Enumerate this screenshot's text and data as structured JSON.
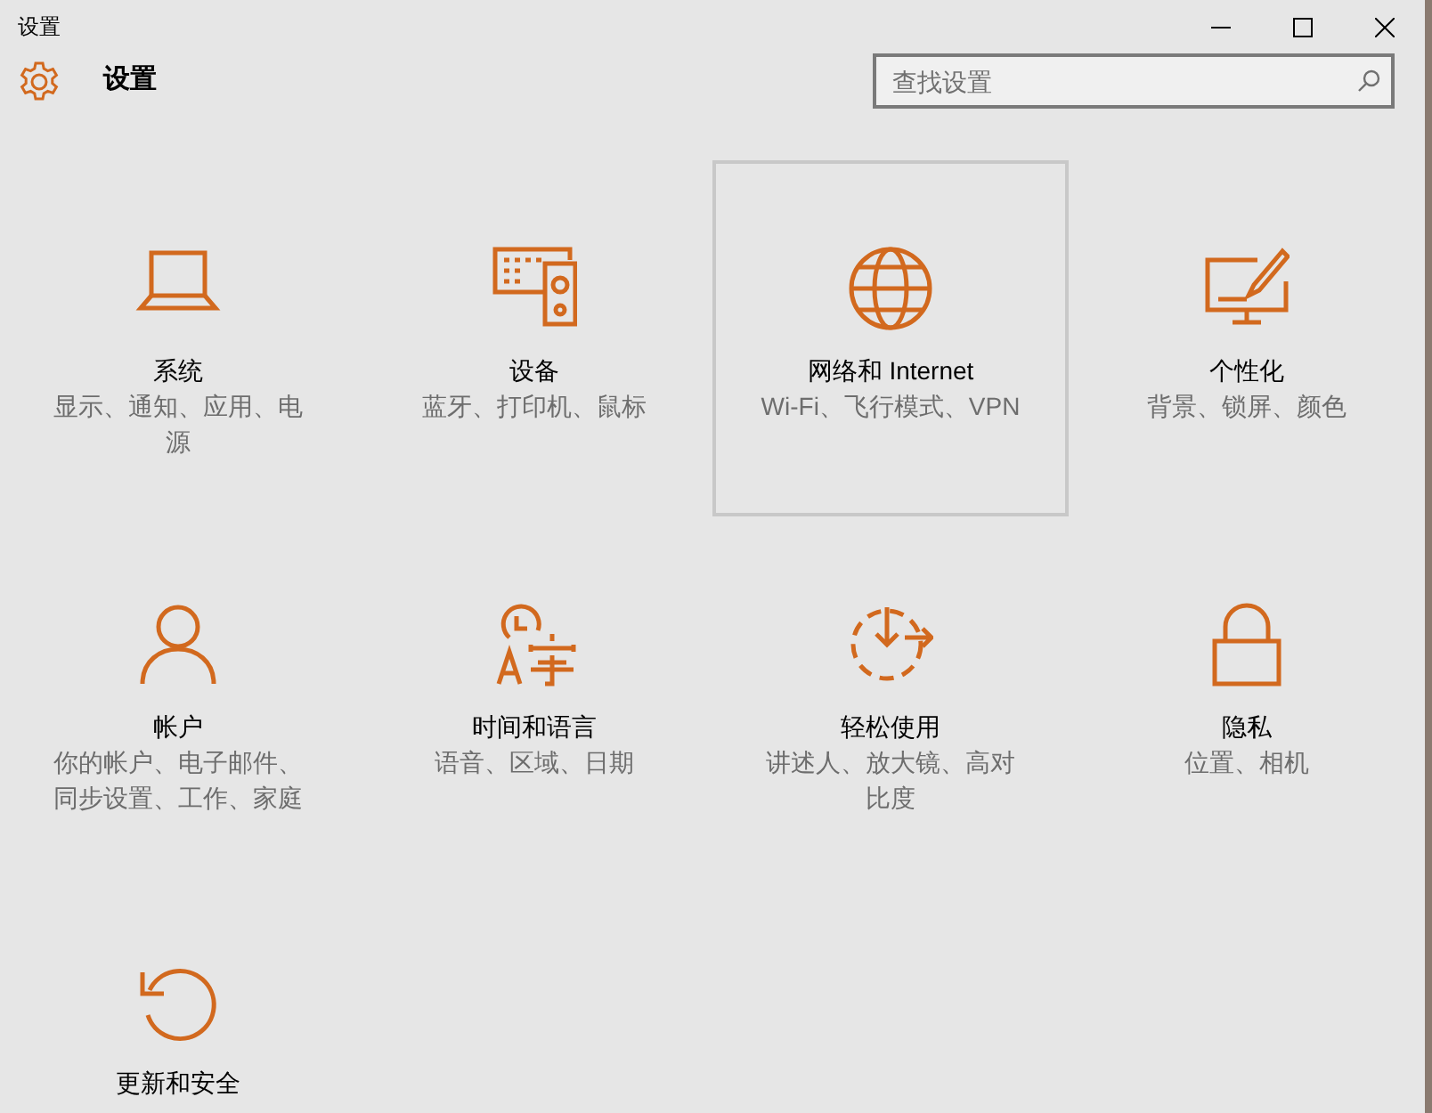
{
  "window": {
    "title": "设置"
  },
  "header": {
    "title": "设置"
  },
  "search": {
    "placeholder": "查找设置"
  },
  "tiles": [
    {
      "title": "系统",
      "subtitle": "显示、通知、应用、电源",
      "selected": false
    },
    {
      "title": "设备",
      "subtitle": "蓝牙、打印机、鼠标",
      "selected": false
    },
    {
      "title": "网络和 Internet",
      "subtitle": "Wi-Fi、飞行模式、VPN",
      "selected": true
    },
    {
      "title": "个性化",
      "subtitle": "背景、锁屏、颜色",
      "selected": false
    },
    {
      "title": "帐户",
      "subtitle": "你的帐户、电子邮件、同步设置、工作、家庭",
      "selected": false
    },
    {
      "title": "时间和语言",
      "subtitle": "语音、区域、日期",
      "selected": false
    },
    {
      "title": "轻松使用",
      "subtitle": "讲述人、放大镜、高对比度",
      "selected": false
    },
    {
      "title": "隐私",
      "subtitle": "位置、相机",
      "selected": false
    },
    {
      "title": "更新和安全",
      "selected": false
    }
  ]
}
